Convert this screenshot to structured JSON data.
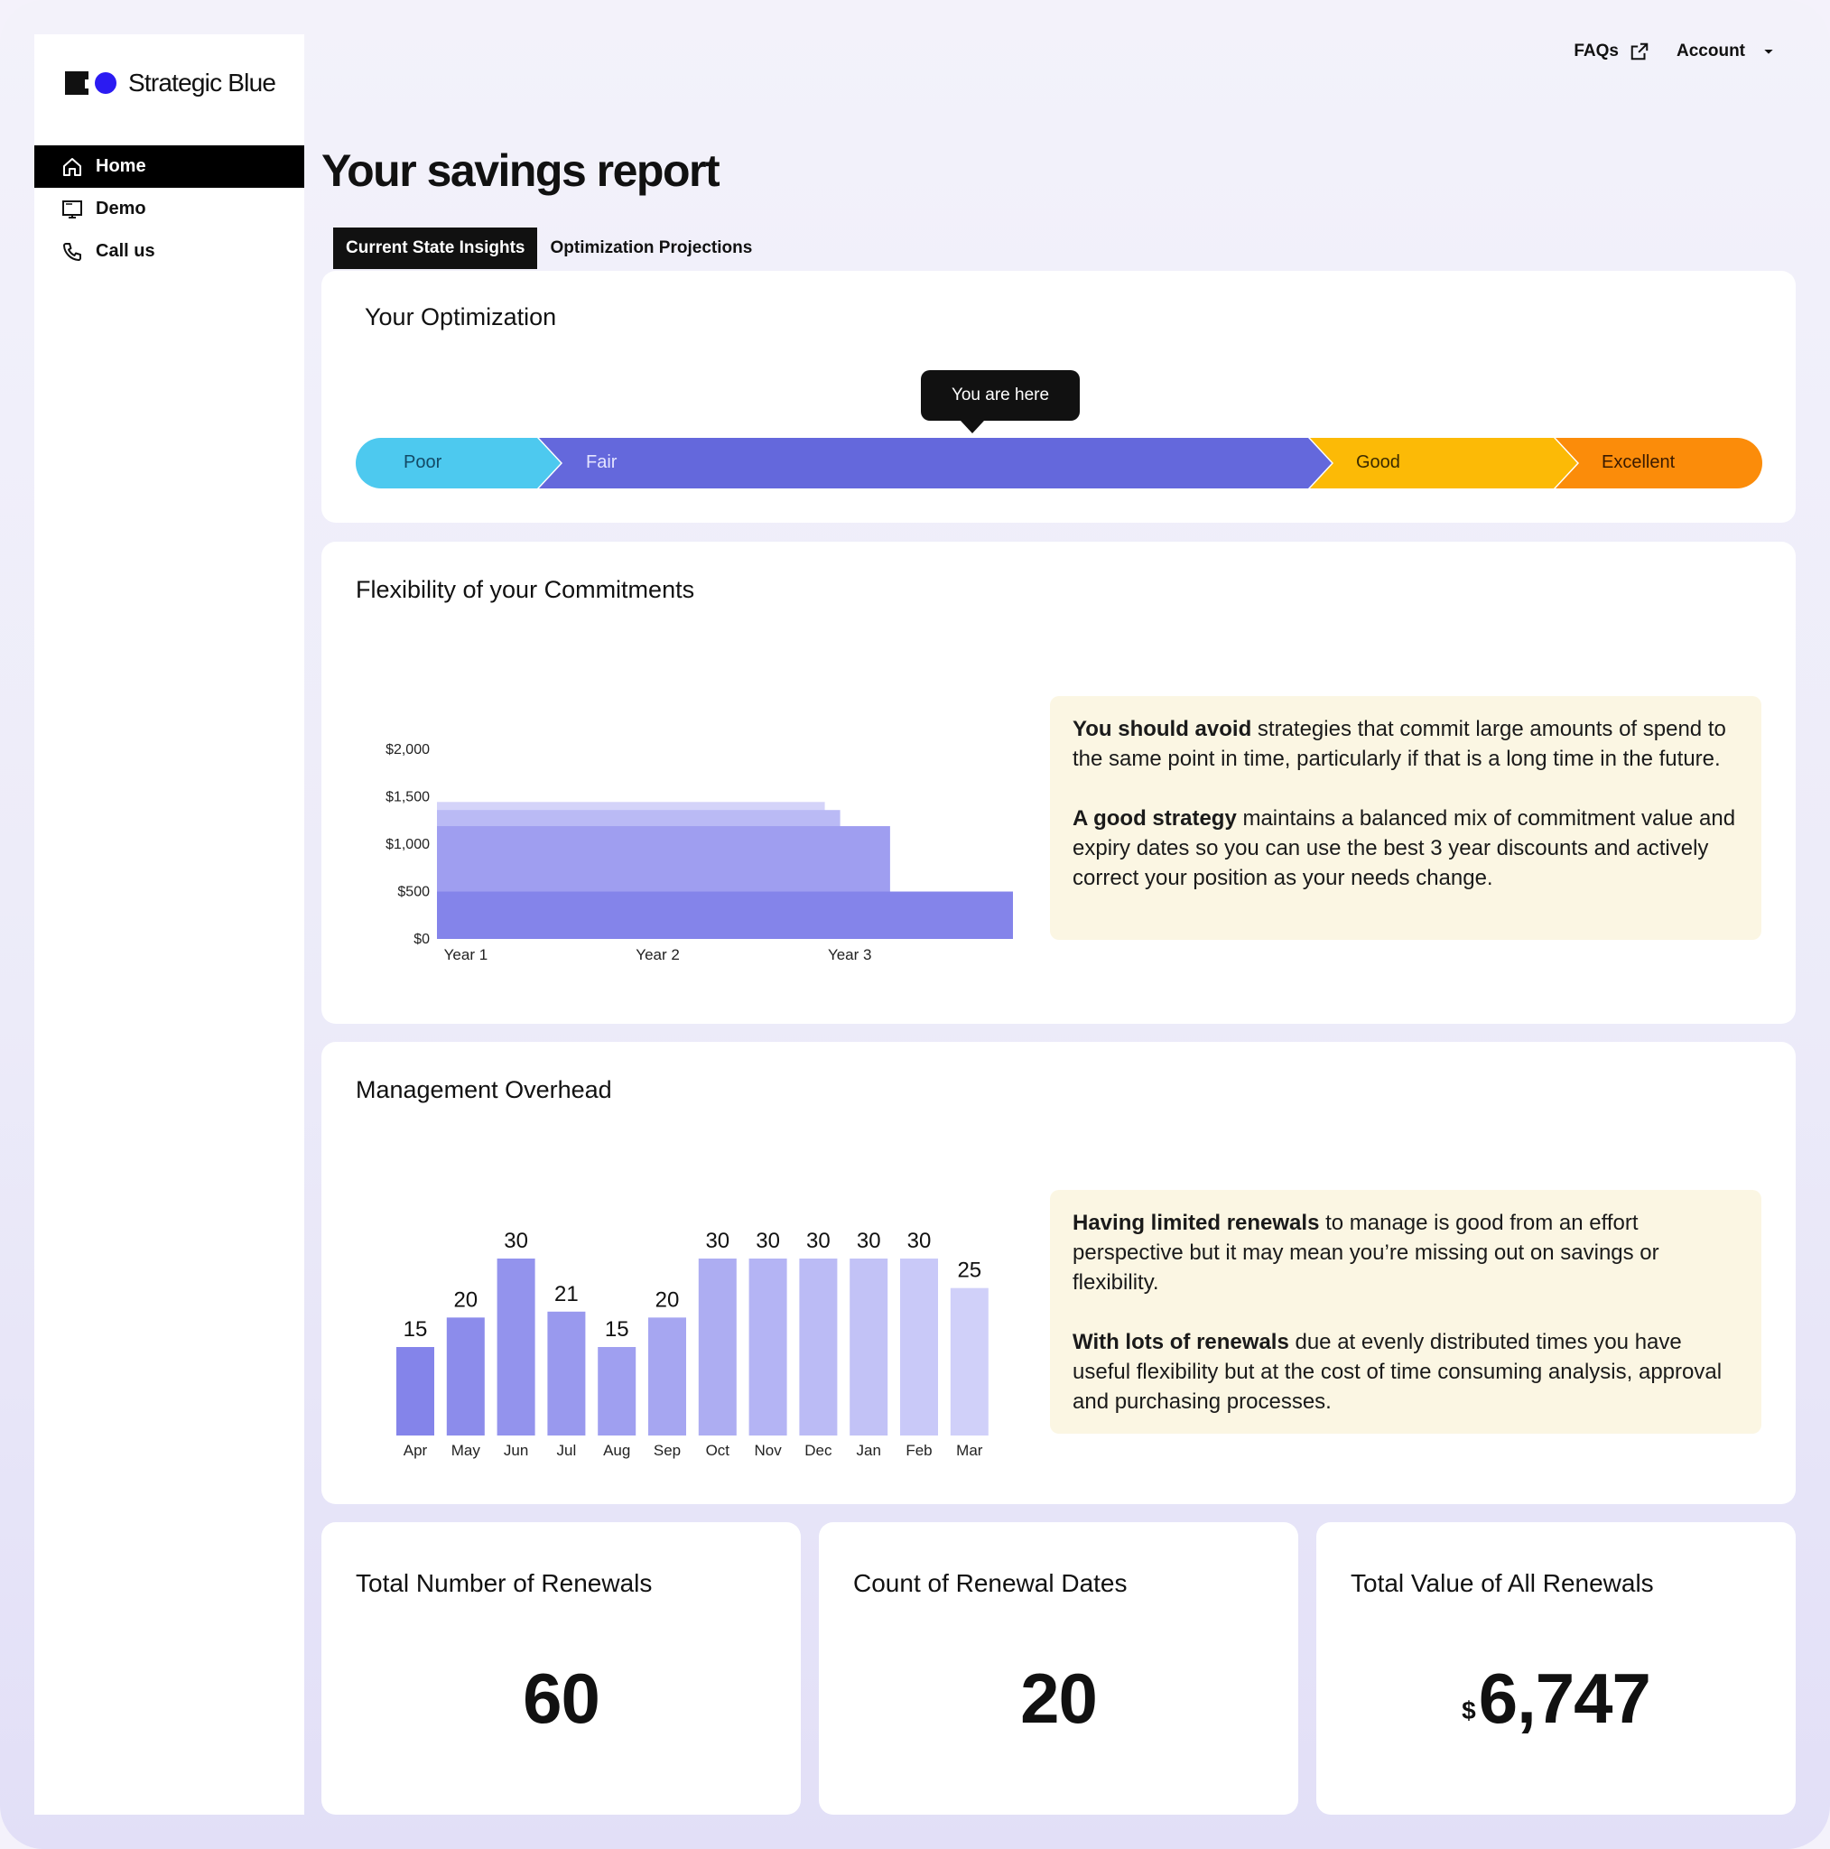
{
  "brand": {
    "name": "Strategic Blue"
  },
  "nav": [
    {
      "label": "Home",
      "icon": "home-icon",
      "active": true
    },
    {
      "label": "Demo",
      "icon": "monitor-icon",
      "active": false
    },
    {
      "label": "Call us",
      "icon": "phone-icon",
      "active": false
    }
  ],
  "toplinks": {
    "faqs": "FAQs",
    "account": "Account"
  },
  "page": {
    "title": "Your savings report"
  },
  "tabs": [
    {
      "label": "Current State Insights",
      "active": true
    },
    {
      "label": "Optimization Projections",
      "active": false
    }
  ],
  "optimization": {
    "title": "Your Optimization",
    "tooltip": "You are here",
    "segments": [
      {
        "label": "Poor",
        "color": "#4dc9ef"
      },
      {
        "label": "Fair",
        "color": "#6468dc"
      },
      {
        "label": "Good",
        "color": "#fcba06"
      },
      {
        "label": "Excellent",
        "color": "#fb8c0a"
      }
    ],
    "current_level": "Fair"
  },
  "flexibility": {
    "title": "Flexibility of your Commitments",
    "info": {
      "p1_bold": "You should avoid",
      "p1_rest": " strategies that commit large amounts of spend to the same point in time, particularly if that is a long time in the future.",
      "p2_bold": "A good strategy",
      "p2_rest": " maintains a balanced mix of commitment value and expiry dates so you can use the best 3 year discounts and actively correct your position as your needs change."
    }
  },
  "overhead": {
    "title": "Management Overhead",
    "info": {
      "p1_bold": "Having limited renewals",
      "p1_rest": " to manage is good from an effort perspective but it may mean you’re missing out on savings or flexibility.",
      "p2_bold": "With lots of renewals",
      "p2_rest": " due at evenly distributed times you have useful flexibility but at the cost of time consuming analysis, approval and purchasing processes."
    }
  },
  "stats": [
    {
      "title": "Total Number of Renewals",
      "value": "60",
      "currency": ""
    },
    {
      "title": "Count of Renewal Dates",
      "value": "20",
      "currency": ""
    },
    {
      "title": "Total Value of All Renewals",
      "value": "6,747",
      "currency": "$"
    }
  ],
  "chart_data": [
    {
      "type": "area",
      "title": "Flexibility of your Commitments",
      "x_tick_labels": [
        "Year 1",
        "Year 2",
        "Year 3"
      ],
      "x_range_years": [
        0,
        3
      ],
      "ylim": [
        0,
        2000
      ],
      "y_tick_labels": [
        "$0",
        "$500",
        "$1,000",
        "$1,500",
        "$2,000"
      ],
      "y_ticks": [
        0,
        500,
        1000,
        1500,
        2000
      ],
      "grid": false,
      "series": [
        {
          "end_year": 3.0,
          "value": 500,
          "color": "#8484ea"
        },
        {
          "end_year": 2.36,
          "value": 1190,
          "color": "#9f9ef0"
        },
        {
          "end_year": 2.1,
          "value": 1360,
          "color": "#babaf5"
        },
        {
          "end_year": 2.02,
          "value": 1445,
          "color": "#d4d3f9"
        }
      ]
    },
    {
      "type": "bar",
      "title": "Management Overhead",
      "categories": [
        "Apr",
        "May",
        "Jun",
        "Jul",
        "Aug",
        "Sep",
        "Oct",
        "Nov",
        "Dec",
        "Jan",
        "Feb",
        "Mar"
      ],
      "values": [
        15,
        20,
        30,
        21,
        15,
        20,
        30,
        30,
        30,
        30,
        30,
        25
      ],
      "ylim": [
        0,
        30
      ],
      "grid": false,
      "colors": [
        "#8484ea",
        "#8c8ceb",
        "#9393ed",
        "#9999ee",
        "#9f9ff0",
        "#a6a6f1",
        "#adadf2",
        "#b4b4f4",
        "#bbbbf5",
        "#c2c2f6",
        "#c9c9f8",
        "#d0d0f9"
      ]
    }
  ]
}
